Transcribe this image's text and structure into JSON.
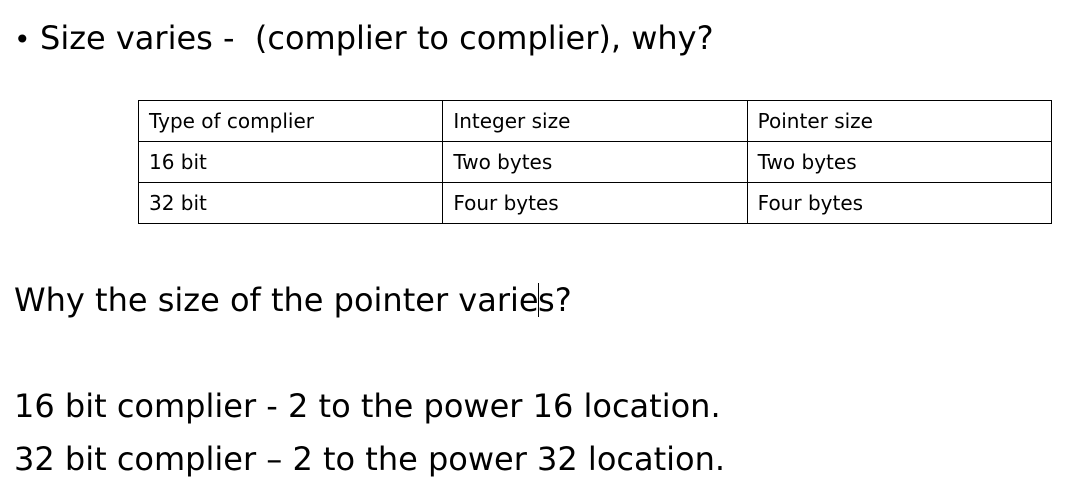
{
  "bullet": {
    "symbol": "•",
    "text": "Size varies -  (complier to complier), why?"
  },
  "table": {
    "rows": [
      [
        "Type of complier",
        "Integer size",
        "Pointer size"
      ],
      [
        "16 bit",
        "Two bytes",
        "Two bytes"
      ],
      [
        "32 bit",
        "Four bytes",
        "Four bytes"
      ]
    ]
  },
  "question": {
    "before_cursor": "Why the size of the pointer varie",
    "after_cursor": "s?"
  },
  "answers": [
    "16 bit complier - 2 to the power 16 location.",
    "32 bit complier – 2 to the power 32 location."
  ]
}
